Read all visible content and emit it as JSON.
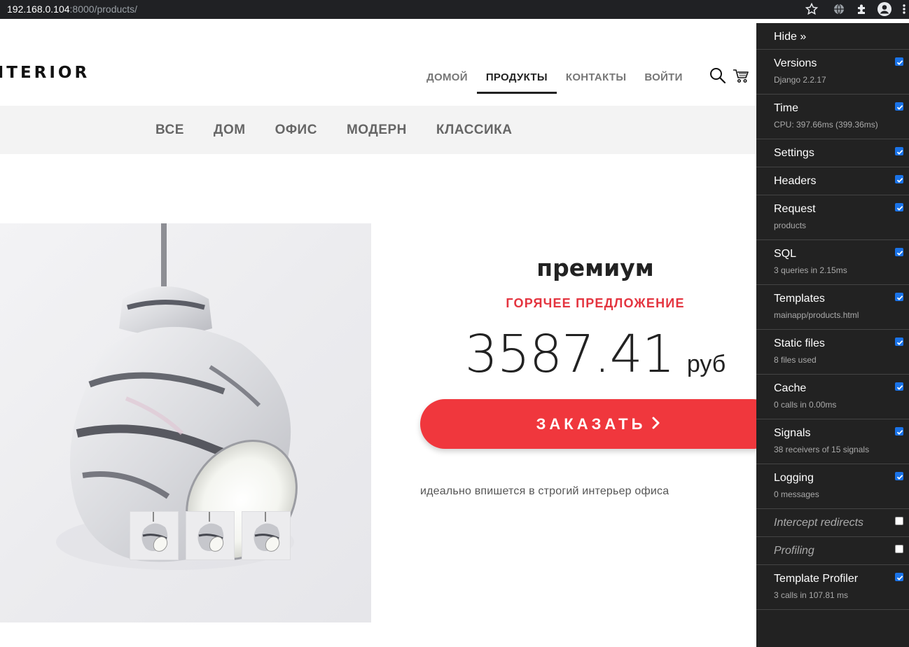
{
  "browser": {
    "url_host": "192.168.0.104",
    "url_rest": ":8000/products/",
    "icons": [
      "star-icon",
      "globe-icon",
      "puzzle-extension-icon",
      "account-icon",
      "more-vert-icon"
    ]
  },
  "site": {
    "logo": "NTERIOR",
    "nav": [
      {
        "label": "ДОМОЙ",
        "active": false
      },
      {
        "label": "ПРОДУКТЫ",
        "active": true
      },
      {
        "label": "КОНТАКТЫ",
        "active": false
      },
      {
        "label": "ВОЙТИ",
        "active": false
      }
    ],
    "categories": [
      "ВСЕ",
      "ДОМ",
      "ОФИС",
      "МОДЕРН",
      "КЛАССИКА"
    ]
  },
  "product": {
    "title": "премиум",
    "badge": "ГОРЯЧЕЕ ПРЕДЛОЖЕНИЕ",
    "price": "3587.41",
    "currency": "руб",
    "order_label": "ЗАКАЗАТЬ",
    "description": "идеально впишется в строгий интерьер офиса",
    "thumbnail_count": 3
  },
  "debug_toolbar": {
    "hide_label": "Hide »",
    "panels": [
      {
        "name": "Versions",
        "sub": "Django 2.2.17",
        "checked": true
      },
      {
        "name": "Time",
        "sub": "CPU: 397.66ms (399.36ms)",
        "checked": true
      },
      {
        "name": "Settings",
        "sub": "",
        "checked": true
      },
      {
        "name": "Headers",
        "sub": "",
        "checked": true
      },
      {
        "name": "Request",
        "sub": "products",
        "checked": true
      },
      {
        "name": "SQL",
        "sub": "3 queries in 2.15ms",
        "checked": true
      },
      {
        "name": "Templates",
        "sub": "mainapp/products.html",
        "checked": true
      },
      {
        "name": "Static files",
        "sub": "8 files used",
        "checked": true
      },
      {
        "name": "Cache",
        "sub": "0 calls in 0.00ms",
        "checked": true
      },
      {
        "name": "Signals",
        "sub": "38 receivers of 15 signals",
        "checked": true
      },
      {
        "name": "Logging",
        "sub": "0 messages",
        "checked": true
      },
      {
        "name": "Intercept redirects",
        "sub": "",
        "checked": false
      },
      {
        "name": "Profiling",
        "sub": "",
        "checked": false
      },
      {
        "name": "Template Profiler",
        "sub": "3 calls in 107.81 ms",
        "checked": true
      }
    ]
  }
}
